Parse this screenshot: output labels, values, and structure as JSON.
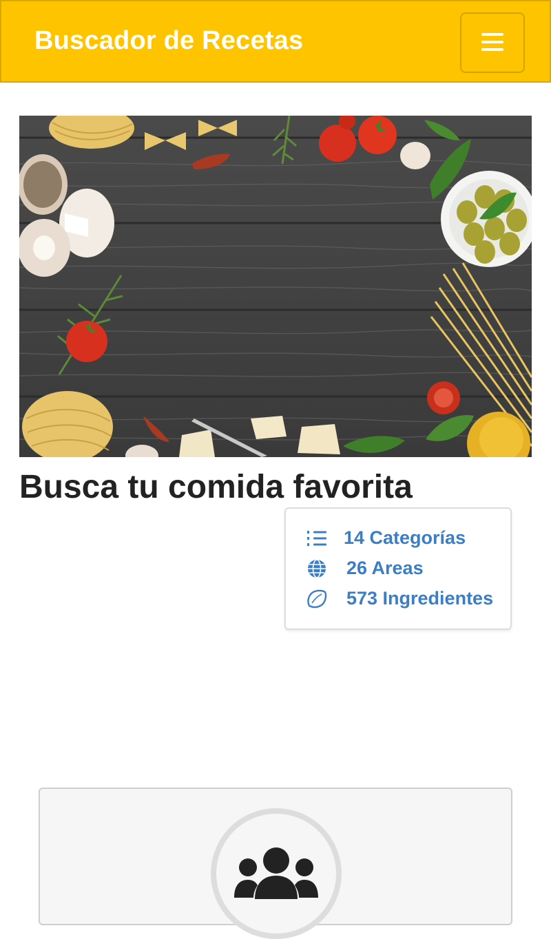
{
  "navbar": {
    "brand": "Buscador de Recetas",
    "menu_icon": "hamburger-menu-icon",
    "background": "#ffc400"
  },
  "hero": {
    "image": "pasta-ingredients-on-dark-wood"
  },
  "main": {
    "title": "Busca tu comida favorita"
  },
  "stats": [
    {
      "icon": "numbered-list-icon",
      "label": "14 Categorías"
    },
    {
      "icon": "globe-icon",
      "label": "26 Areas"
    },
    {
      "icon": "lemon-icon",
      "label": "573 Ingredientes"
    }
  ],
  "bottom_card": {
    "icon": "users-group-icon"
  },
  "colors": {
    "accent": "#ffc400",
    "link": "#3b7ec4",
    "text": "#222222"
  }
}
